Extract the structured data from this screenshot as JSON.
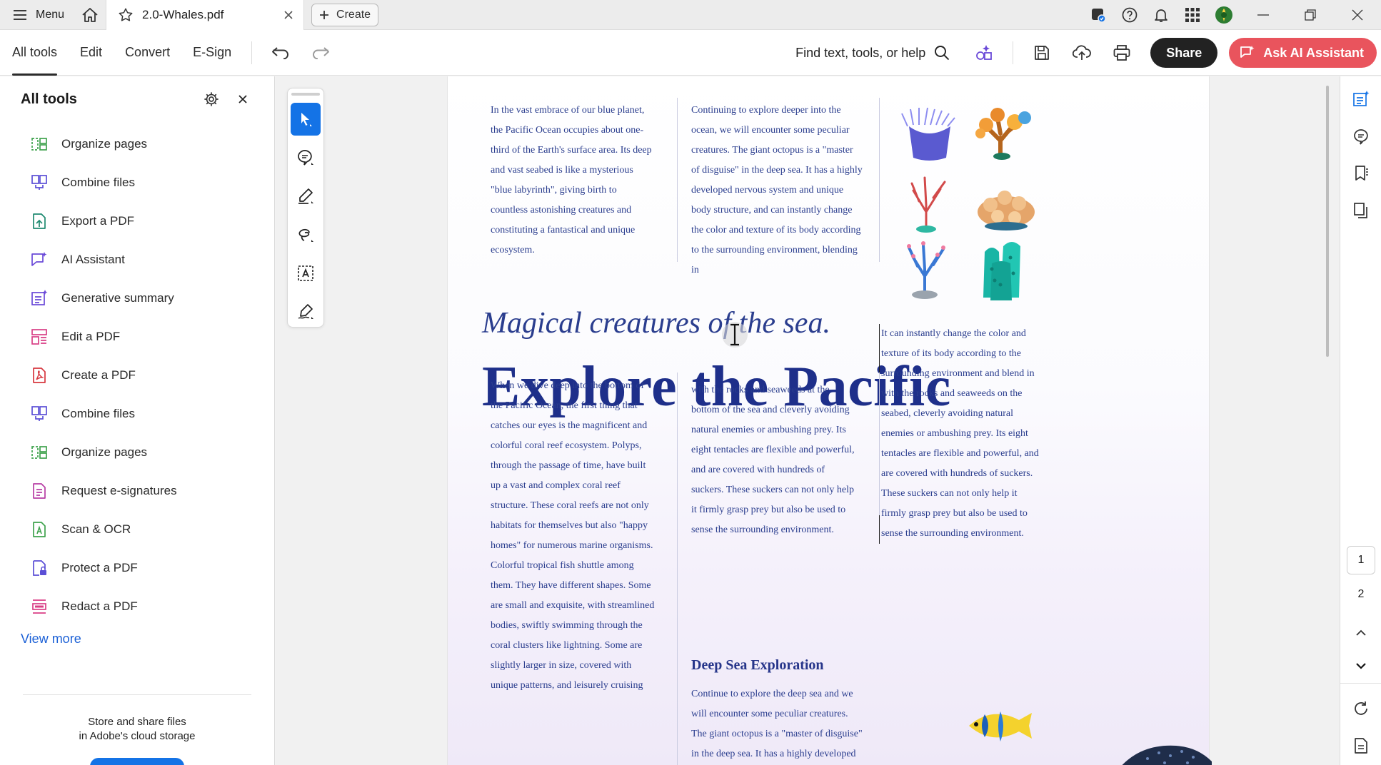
{
  "titlebar": {
    "menu_label": "Menu",
    "tab_title": "2.0-Whales.pdf",
    "create_label": "Create",
    "icons": [
      "home-icon",
      "star-icon",
      "close-tab-icon",
      "plus-icon",
      "mobile-icon",
      "help-icon",
      "bell-icon",
      "apps-icon",
      "avatar",
      "minimize-icon",
      "restore-icon",
      "close-window-icon"
    ]
  },
  "toolbar": {
    "tabs": [
      {
        "label": "All tools"
      },
      {
        "label": "Edit"
      },
      {
        "label": "Convert"
      },
      {
        "label": "E-Sign"
      }
    ],
    "active_tab": "All tools",
    "find_placeholder": "Find text, tools, or help",
    "share_label": "Share",
    "ai_label": "Ask AI Assistant",
    "accent_color": "#e9545d"
  },
  "left_panel": {
    "title": "All tools",
    "tools": [
      {
        "label": "Organize pages",
        "icon": "organize-pages-icon",
        "color": "#3fa34d"
      },
      {
        "label": "Combine files",
        "icon": "combine-files-icon",
        "color": "#5b4fd6"
      },
      {
        "label": "Export a PDF",
        "icon": "export-pdf-icon",
        "color": "#1f8a70"
      },
      {
        "label": "AI Assistant",
        "icon": "ai-assistant-icon",
        "color": "#6a49d8"
      },
      {
        "label": "Generative summary",
        "icon": "generative-summary-icon",
        "color": "#6a49d8"
      },
      {
        "label": "Edit a PDF",
        "icon": "edit-pdf-icon",
        "color": "#d93f86"
      },
      {
        "label": "Create a PDF",
        "icon": "create-pdf-icon",
        "color": "#d7373f"
      },
      {
        "label": "Combine files",
        "icon": "combine-files-icon",
        "color": "#5b4fd6"
      },
      {
        "label": "Organize pages",
        "icon": "organize-pages-icon",
        "color": "#3fa34d"
      },
      {
        "label": "Request e-signatures",
        "icon": "request-esign-icon",
        "color": "#b83ea5"
      },
      {
        "label": "Scan & OCR",
        "icon": "scan-ocr-icon",
        "color": "#3fa34d"
      },
      {
        "label": "Protect a PDF",
        "icon": "protect-pdf-icon",
        "color": "#5b4fd6"
      },
      {
        "label": "Redact a PDF",
        "icon": "redact-pdf-icon",
        "color": "#d93f86"
      }
    ],
    "view_more": "View more",
    "footer_line1": "Store and share files",
    "footer_line2": "in Adobe's cloud storage"
  },
  "document": {
    "col1_top": "In the vast embrace of our blue planet, the Pacific Ocean occupies about one-third of the Earth's surface area. Its deep and vast seabed is like a mysterious \"blue labyrinth\", giving birth to countless astonishing creatures and constituting a fantastical and unique ecosystem.",
    "col2_top": "Continuing to explore deeper into the ocean, we will encounter some peculiar creatures. The giant octopus is a \"master of disguise\" in the deep sea. It has a highly developed nervous system and unique body structure, and can instantly change the color and texture of its body according to the surrounding environment, blending in",
    "subtitle": "Magical creatures of the sea.",
    "title": "Explore the Pacific",
    "col3_right": "It can instantly change the color and texture of its body according to the surrounding environment and blend in with the rocks and seaweeds on the seabed, cleverly avoiding natural enemies or ambushing prey. Its eight tentacles are flexible and powerful, and are covered with hundreds of suckers. These suckers can not only help it firmly grasp prey but also be used to sense the surrounding environment.",
    "col1_bottom": "When we dive deep into the bottom of the Pacific Ocean, the first thing that catches our eyes is the magnificent and colorful coral reef ecosystem. Polyps, through the passage of time, have built up a vast and complex coral reef structure. These coral reefs are not only habitats for themselves but also \"happy homes\" for numerous marine organisms. Colorful tropical fish shuttle among them. They have different shapes. Some are small and exquisite, with streamlined bodies, swiftly swimming through the coral clusters like lightning. Some are slightly larger in size, covered with unique patterns, and leisurely cruising",
    "col2_bottom": "with the rocks and seaweeds at the bottom of the sea and cleverly avoiding natural enemies or ambushing prey. Its eight tentacles are flexible and powerful, and are covered with hundreds of suckers. These suckers can not only help it firmly grasp prey but also be used to sense the surrounding environment.",
    "section_heading": "Deep Sea Exploration",
    "section_body": "Continue to explore the deep sea and we will encounter some peculiar creatures. The giant octopus is a \"master of disguise\" in the deep sea. It has a highly developed",
    "text_color": "#2a3d8e"
  },
  "page_nav": {
    "pages": [
      "1",
      "2"
    ],
    "current_page": "1"
  }
}
